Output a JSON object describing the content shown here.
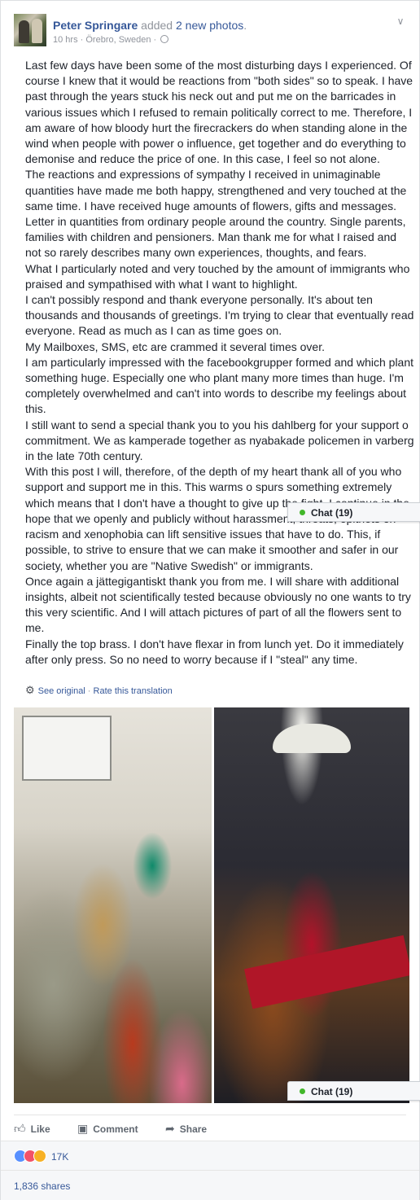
{
  "post": {
    "author": "Peter Springare",
    "action_text": " added ",
    "action_link": "2 new photos",
    "period": ".",
    "time": "10 hrs",
    "sep1": " · ",
    "location": "Örebro, Sweden",
    "sep2": " · ",
    "privacy_icon": "globe-icon",
    "menu_icon": "chevron-down-icon",
    "paragraphs": [
      "Last few days have been some of the most disturbing days I experienced. Of course I knew that it would be reactions from \"both sides\" so to speak. I have past through the years stuck his neck out and put me on the barricades in various issues which I refused to remain politically correct to me. Therefore, I am aware of how bloody hurt the firecrackers do when standing alone in the wind when people with power o influence, get together and do everything to demonise and reduce the price of one. In this case, I feel so not alone.",
      "The reactions and expressions of sympathy I received in unimaginable quantities have made me both happy, strengthened and very touched at the same time. I have received huge amounts of flowers, gifts and messages. Letter in quantities from ordinary people around the country. Single parents, families with children and pensioners. Man thank me for what I raised and not so rarely describes many own experiences, thoughts, and fears.",
      "What I particularly noted and very touched by the amount of immigrants who praised and sympathised with what I want to highlight.",
      "I can't possibly respond and thank everyone personally. It's about ten thousands and thousands of greetings. I'm trying to clear that eventually read everyone. Read as much as I can as time goes on.",
      "My Mailboxes, SMS, etc are crammed it several times over.",
      "I am particularly impressed with the facebookgrupper formed and which plant something huge. Especially one who plant many more times than huge. I'm completely overwhelmed and can't into words to describe my feelings about this.",
      "I still want to send a special thank you to you his dahlberg for your support o commitment. We as kamperade together as nyabakade policemen in varberg in the late 70th century.",
      "With this post I will, therefore, of the depth of my heart thank all of you who support and support me in this. This warms o spurs something extremely which means that I don't have a thought to give up the fight. I continue in the hope that we openly and publicly without harassment, threats, epithets on racism and xenophobia can lift sensitive issues that have to do. This, if possible, to strive to ensure that we can make it smoother and safer in our society, whether you are \"Native Swedish\" or immigrants.",
      "Once again a jättegigantiskt thank you from me. I will share with additional insights, albeit not scientifically tested because obviously no one wants to try this very scientific. And I will attach pictures of part of all the flowers sent to me.",
      "Finally the top brass. I don't have flexar in from lunch yet. Do it immediately after only press. So no need to worry because if I \"steal\" any time."
    ],
    "translation": {
      "see_original": "See original",
      "separator": " · ",
      "rate": "Rate this translation"
    },
    "photos": [
      {
        "alt": "Bouquets of flowers piled in an office"
      },
      {
        "alt": "Roses in vases on a kitchen table"
      }
    ]
  },
  "actions": {
    "like": "Like",
    "comment": "Comment",
    "share": "Share"
  },
  "reactions": {
    "count": "17K",
    "types": [
      "like",
      "love",
      "wow"
    ],
    "colors": {
      "like": "#5890ff",
      "love": "#f25268",
      "wow": "#f7b125"
    }
  },
  "shares": "1,836 shares",
  "chat": {
    "label": "Chat (19)",
    "status_color": "#42b72a"
  },
  "colors": {
    "link": "#365899",
    "text": "#1d2129",
    "muted": "#90949c"
  }
}
